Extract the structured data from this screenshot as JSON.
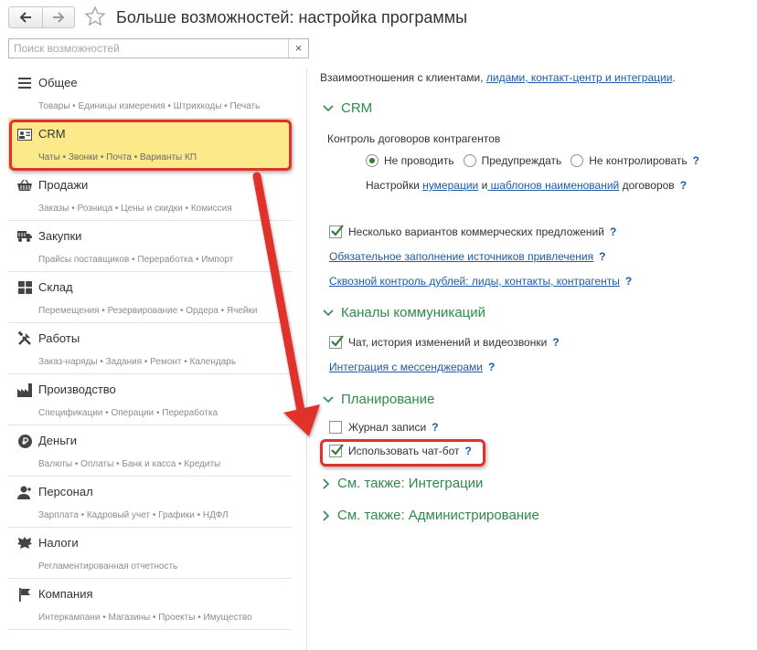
{
  "window": {
    "title": "Больше возможностей: настройка программы"
  },
  "toolbar": {
    "back_icon": "arrow-left-icon",
    "forward_icon": "arrow-right-icon",
    "favorite_icon": "star-icon"
  },
  "search": {
    "placeholder": "Поиск возможностей",
    "value": "",
    "clear_label": "×"
  },
  "sidebar": {
    "items": [
      {
        "title": "Общее",
        "sub": "Товары • Единицы измерения • Штрихкоды • Печать",
        "icon": "menu-lines-icon"
      },
      {
        "title": "CRM",
        "sub": "Чаты • Звонки • Почта • Варианты КП",
        "icon": "contact-card-icon",
        "selected": true
      },
      {
        "title": "Продажи",
        "sub": "Заказы • Розница • Цены и скидки • Комиссия",
        "icon": "basket-icon"
      },
      {
        "title": "Закупки",
        "sub": "Прайсы поставщиков • Переработка • Импорт",
        "icon": "truck-icon"
      },
      {
        "title": "Склад",
        "sub": "Перемещения • Резервирование • Ордера • Ячейки",
        "icon": "warehouse-grid-icon"
      },
      {
        "title": "Работы",
        "sub": "Заказ-наряды • Задания • Ремонт • Календарь",
        "icon": "tools-icon"
      },
      {
        "title": "Производство",
        "sub": "Спецификации • Операции • Переработка",
        "icon": "factory-icon"
      },
      {
        "title": "Деньги",
        "sub": "Валюты • Оплаты • Банк и касса • Кредиты",
        "icon": "ruble-coin-icon"
      },
      {
        "title": "Персонал",
        "sub": "Зарплата • Кадровый учет • Графики • НДФЛ",
        "icon": "person-icon"
      },
      {
        "title": "Налоги",
        "sub": "Регламентированная отчетность",
        "icon": "eagle-emblem-icon"
      },
      {
        "title": "Компания",
        "sub": "Интеркампани • Магазины • Проекты • Имущество",
        "icon": "flag-icon"
      }
    ]
  },
  "main": {
    "intro_text": "Взаимоотношения с клиентами, ",
    "intro_link": "лидами, контакт-центр и интеграции",
    "intro_end": ".",
    "crm": {
      "header": "CRM",
      "contracts_label": "Контроль договоров контрагентов",
      "radios": [
        {
          "label": "Не проводить",
          "checked": true
        },
        {
          "label": "Предупреждать",
          "checked": false
        },
        {
          "label": "Не контролировать",
          "checked": false
        }
      ],
      "settings_prefix": "Настройки ",
      "settings_link1": "нумерации",
      "settings_mid": " и",
      "settings_link2": " шаблонов наименований",
      "settings_suffix": " договоров",
      "multi_offers_label": "Несколько вариантов коммерческих предложений",
      "multi_offers_checked": true,
      "lead_sources_link": "Обязательное заполнение источников привлечения",
      "duplicates_link": "Сквозной контроль дублей: лиды, контакты, контрагенты"
    },
    "channels": {
      "header": "Каналы коммуникаций",
      "chat_label": "Чат, история изменений и видеозвонки",
      "chat_checked": true,
      "messengers_link": "Интеграция с мессенджерами"
    },
    "planning": {
      "header": "Планирование",
      "journal_label": "Журнал записи",
      "journal_checked": false,
      "chatbot_label": "Использовать чат-бот",
      "chatbot_checked": true
    },
    "see_also": [
      {
        "label": "См. также: Интеграции"
      },
      {
        "label": "См. также: Администрирование"
      }
    ],
    "help_mark": "?"
  },
  "colors": {
    "selected_bg": "#fce98a",
    "section_green": "#2e8b4a",
    "link_blue": "#1d5aa7",
    "annotation_red": "#e0322a"
  }
}
